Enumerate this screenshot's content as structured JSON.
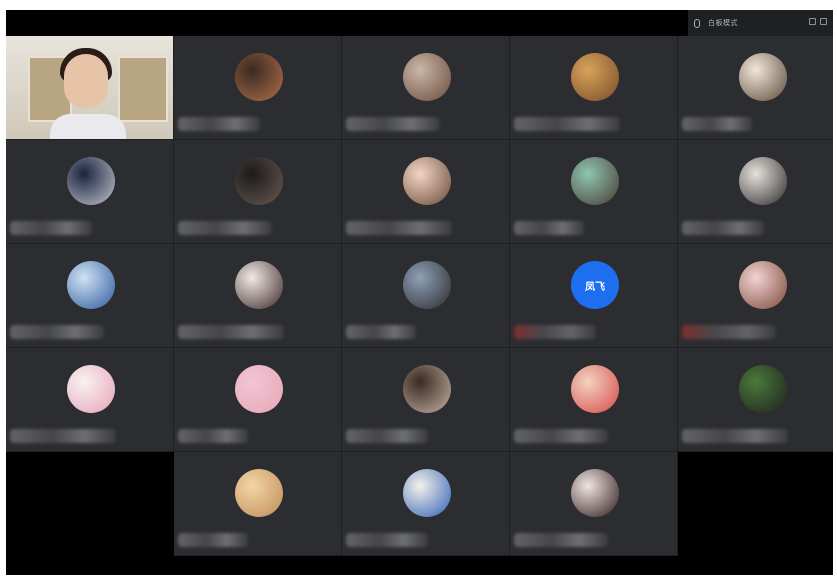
{
  "topbar": {
    "title": "白板模式"
  },
  "participants": [
    {
      "id": "self",
      "avatar": "self-video",
      "colors": []
    },
    {
      "id": "p2",
      "avatar": "user-avatar",
      "colors": [
        "#3a2a22",
        "#b06f4a"
      ]
    },
    {
      "id": "p3",
      "avatar": "user-avatar",
      "colors": [
        "#c9b7a8",
        "#6b4a3a"
      ]
    },
    {
      "id": "p4",
      "avatar": "user-avatar",
      "colors": [
        "#d7a35a",
        "#7a4b2a"
      ]
    },
    {
      "id": "p5",
      "avatar": "user-avatar",
      "colors": [
        "#f1e7d8",
        "#5b4a3c"
      ]
    },
    {
      "id": "p6",
      "avatar": "user-avatar",
      "colors": [
        "#1a2340",
        "#c3c6cf"
      ]
    },
    {
      "id": "p7",
      "avatar": "user-avatar",
      "colors": [
        "#1b1b1b",
        "#6a5a52"
      ]
    },
    {
      "id": "p8",
      "avatar": "user-avatar",
      "colors": [
        "#f2d5c2",
        "#6a4a3a"
      ]
    },
    {
      "id": "p9",
      "avatar": "user-avatar",
      "colors": [
        "#8cc6b0",
        "#4a3a33"
      ]
    },
    {
      "id": "p10",
      "avatar": "user-avatar",
      "colors": [
        "#e7e1dc",
        "#2b2b2b"
      ]
    },
    {
      "id": "p11",
      "avatar": "user-avatar",
      "colors": [
        "#cfe2f6",
        "#2d5a9a"
      ]
    },
    {
      "id": "p12",
      "avatar": "user-avatar",
      "colors": [
        "#f3e9e4",
        "#3a2a2a"
      ]
    },
    {
      "id": "p13",
      "avatar": "user-avatar",
      "colors": [
        "#8ea0b6",
        "#2b2b2f"
      ]
    },
    {
      "id": "p14",
      "avatar": "initials",
      "initials": "凤飞",
      "colors": [
        "#1e6ff0",
        "#1e6ff0"
      ]
    },
    {
      "id": "p15",
      "avatar": "user-avatar",
      "colors": [
        "#f3d3d3",
        "#7a4a3a"
      ]
    },
    {
      "id": "p16",
      "avatar": "user-avatar",
      "colors": [
        "#f7f2f2",
        "#e7a2b6"
      ]
    },
    {
      "id": "p17",
      "avatar": "user-avatar",
      "colors": [
        "#f1c4d7",
        "#e8a7b2"
      ]
    },
    {
      "id": "p18",
      "avatar": "user-avatar",
      "colors": [
        "#3a2a22",
        "#c5b2a3"
      ]
    },
    {
      "id": "p19",
      "avatar": "user-avatar",
      "colors": [
        "#f3d2c1",
        "#d64a4a"
      ]
    },
    {
      "id": "p20",
      "avatar": "user-avatar",
      "colors": [
        "#4a7a3a",
        "#1f1f1f"
      ]
    },
    {
      "id": "p21",
      "avatar": "user-avatar",
      "colors": [
        "#f2d6a4",
        "#c08a5a"
      ]
    },
    {
      "id": "p22",
      "avatar": "user-avatar",
      "colors": [
        "#f4f1ea",
        "#2f5fb5"
      ]
    },
    {
      "id": "p23",
      "avatar": "user-avatar",
      "colors": [
        "#f0e4e0",
        "#2a1c1c"
      ]
    }
  ],
  "names_visible": false
}
